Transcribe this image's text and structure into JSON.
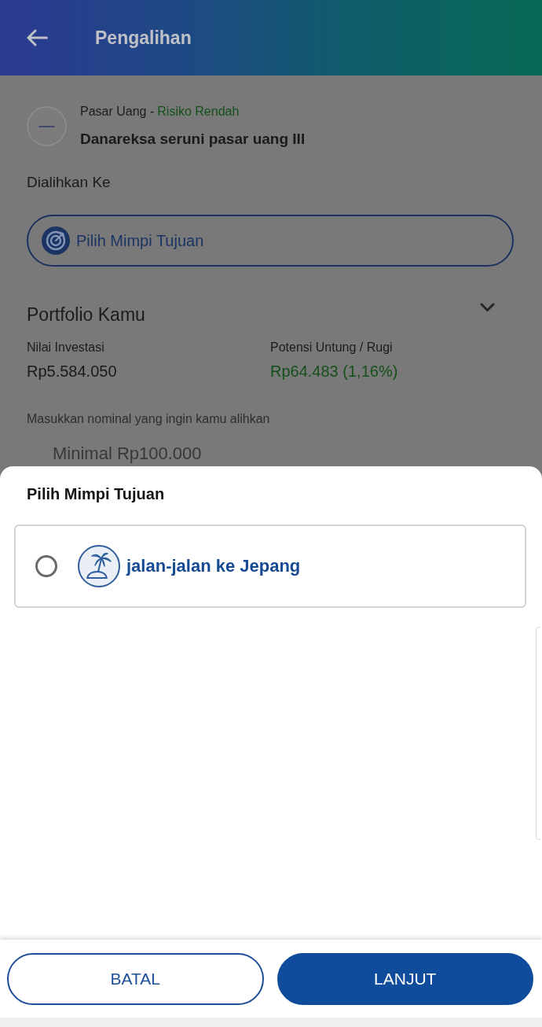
{
  "app_bar": {
    "title": "Pengalihan"
  },
  "fund": {
    "category": "Pasar Uang -",
    "risk": "Risiko Rendah",
    "name": "Danareksa seruni pasar uang III"
  },
  "destination": {
    "label": "Dialihkan Ke",
    "button": "Pilih Mimpi Tujuan"
  },
  "portfolio": {
    "title": "Portfolio Kamu",
    "stats": [
      {
        "label": "Nilai Investasi",
        "value": "Rp5.584.050",
        "kind": "neutral"
      },
      {
        "label": "Potensi Untung / Rugi",
        "value": "Rp64.483 (1,16%)",
        "kind": "gain"
      }
    ]
  },
  "amount": {
    "label": "Masukkan nominal yang ingin kamu alihkan",
    "placeholder": "Minimal Rp100.000"
  },
  "sheet": {
    "title": "Pilih Mimpi Tujuan",
    "options": [
      {
        "label": "jalan-jalan ke Jepang",
        "selected": false
      }
    ]
  },
  "buttons": [
    {
      "label": "BATAL",
      "kind": "secondary"
    },
    {
      "label": "LANJUT",
      "kind": "primary"
    }
  ]
}
